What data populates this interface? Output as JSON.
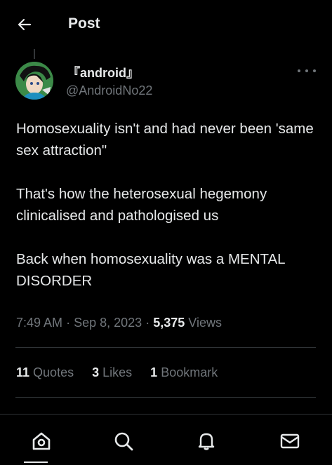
{
  "header": {
    "title": "Post"
  },
  "author": {
    "display_name": "『android』",
    "handle": "@AndroidNo22"
  },
  "tweet": {
    "paragraphs": [
      "Homosexuality isn't and had never been 'same sex attraction\"",
      "That's how the heterosexual hegemony clinicalised and pathologised us",
      "Back when homosexuality was a MENTAL DISORDER"
    ],
    "time": "7:49 AM",
    "date": "Sep 8, 2023",
    "separator": "·",
    "views_count": "5,375",
    "views_label": "Views"
  },
  "stats": {
    "quotes_count": "11",
    "quotes_label": "Quotes",
    "likes_count": "3",
    "likes_label": "Likes",
    "bookmarks_count": "1",
    "bookmarks_label": "Bookmark"
  },
  "nav": {
    "items": [
      "home-icon",
      "search-icon",
      "notifications-icon",
      "messages-icon"
    ]
  },
  "colors": {
    "background": "#000000",
    "text": "#e7e9ea",
    "secondary": "#71767b",
    "divider": "#2f3336"
  }
}
